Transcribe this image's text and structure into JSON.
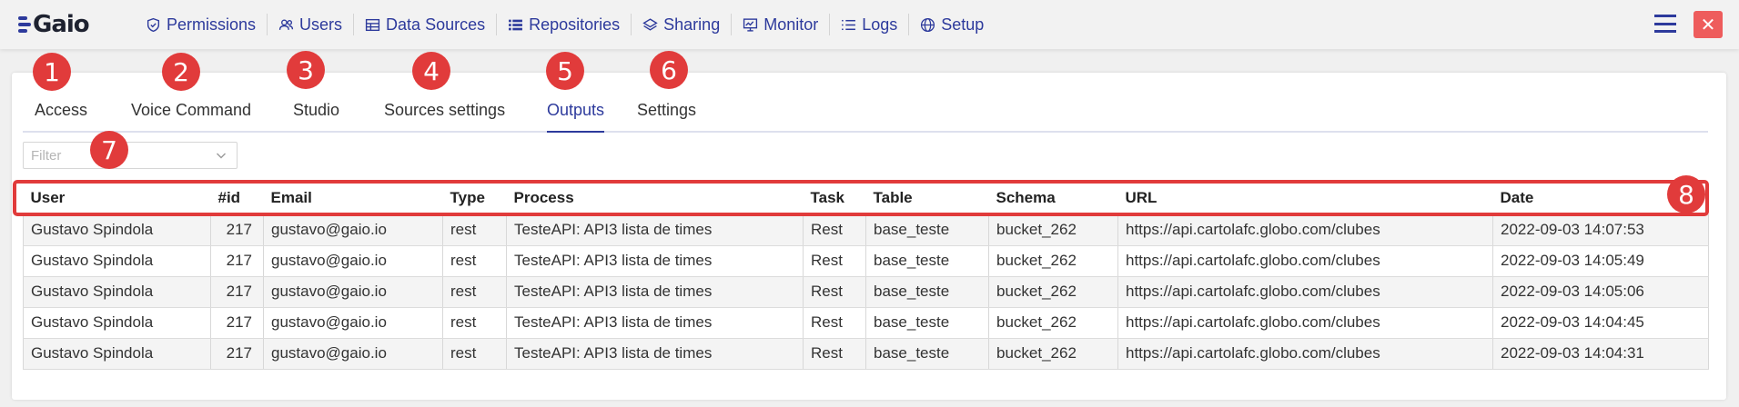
{
  "app": {
    "logo_text": "Gaio"
  },
  "nav": [
    {
      "label": "Permissions",
      "icon": "shield-icon"
    },
    {
      "label": "Users",
      "icon": "users-icon"
    },
    {
      "label": "Data Sources",
      "icon": "table-icon"
    },
    {
      "label": "Repositories",
      "icon": "list-icon"
    },
    {
      "label": "Sharing",
      "icon": "layers-icon"
    },
    {
      "label": "Monitor",
      "icon": "monitor-icon"
    },
    {
      "label": "Logs",
      "icon": "logs-icon"
    },
    {
      "label": "Setup",
      "icon": "globe-icon"
    }
  ],
  "window": {
    "close_label": "✕"
  },
  "tabs": [
    {
      "label": "Access",
      "active": false
    },
    {
      "label": "Voice Command",
      "active": false
    },
    {
      "label": "Studio",
      "active": false
    },
    {
      "label": "Sources settings",
      "active": false
    },
    {
      "label": "Outputs",
      "active": true
    },
    {
      "label": "Settings",
      "active": false
    }
  ],
  "filter": {
    "placeholder": "Filter",
    "value": ""
  },
  "table": {
    "columns": [
      "User",
      "#id",
      "Email",
      "Type",
      "Process",
      "Task",
      "Table",
      "Schema",
      "URL",
      "Date"
    ],
    "rows": [
      [
        "Gustavo Spindola",
        "217",
        "gustavo@gaio.io",
        "rest",
        "TesteAPI: API3 lista de times",
        "Rest",
        "base_teste",
        "bucket_262",
        "https://api.cartolafc.globo.com/clubes",
        "2022-09-03 14:07:53"
      ],
      [
        "Gustavo Spindola",
        "217",
        "gustavo@gaio.io",
        "rest",
        "TesteAPI: API3 lista de times",
        "Rest",
        "base_teste",
        "bucket_262",
        "https://api.cartolafc.globo.com/clubes",
        "2022-09-03 14:05:49"
      ],
      [
        "Gustavo Spindola",
        "217",
        "gustavo@gaio.io",
        "rest",
        "TesteAPI: API3 lista de times",
        "Rest",
        "base_teste",
        "bucket_262",
        "https://api.cartolafc.globo.com/clubes",
        "2022-09-03 14:05:06"
      ],
      [
        "Gustavo Spindola",
        "217",
        "gustavo@gaio.io",
        "rest",
        "TesteAPI: API3 lista de times",
        "Rest",
        "base_teste",
        "bucket_262",
        "https://api.cartolafc.globo.com/clubes",
        "2022-09-03 14:04:45"
      ],
      [
        "Gustavo Spindola",
        "217",
        "gustavo@gaio.io",
        "rest",
        "TesteAPI: API3 lista de times",
        "Rest",
        "base_teste",
        "bucket_262",
        "https://api.cartolafc.globo.com/clubes",
        "2022-09-03 14:04:31"
      ]
    ]
  },
  "annotations": [
    "1",
    "2",
    "3",
    "4",
    "5",
    "6",
    "7",
    "8"
  ],
  "colors": {
    "accent": "#2d3a9c",
    "annotation": "#e13b3b",
    "close": "#ee5c5c"
  }
}
